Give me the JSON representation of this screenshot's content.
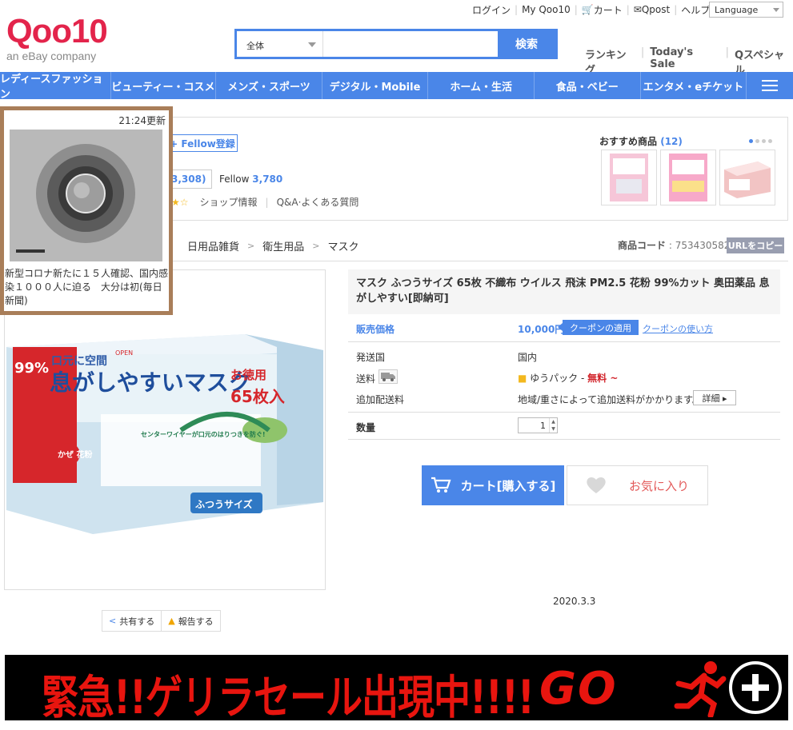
{
  "header": {
    "top_links": [
      "ログイン",
      "My Qoo10",
      "カート",
      "Qpost",
      "ヘルプ"
    ],
    "language_label": "Language",
    "logo_text": "Qoo10",
    "logo_sub": "an eBay company",
    "search": {
      "category": "全体",
      "button": "検索",
      "placeholder": ""
    },
    "sub_links": [
      "ランキング",
      "Today's Sale",
      "Qスペシャル"
    ]
  },
  "nav": {
    "items": [
      "レディースファッション",
      "ビューティー・コスメ",
      "メンズ・スポーツ",
      "デジタル・Mobile",
      "ホーム・生活",
      "食品・ベビー",
      "エンタメ・eチケット"
    ]
  },
  "shop": {
    "fellow_button": "+ Fellow登録",
    "review_count": "3,308)",
    "fellow_label": "Fellow",
    "fellow_count": "3,780",
    "shop_info": "ショップ情報",
    "qa": "Q&A·よくある質問",
    "recommend_title": "おすすめ商品",
    "recommend_count": "(12)"
  },
  "breadcrumb": [
    "日用品雑貨",
    "衛生用品",
    "マスク"
  ],
  "product": {
    "code_label": "商品コード",
    "code": ": 753430582",
    "url_copy": "URLをコピー",
    "title": "マスク ふつうサイズ 65枚 不織布 ウイルス 飛沫 PM2.5 花粉 99%カット 奥田薬品 息がしやすい[即納可]",
    "price_label": "販売価格",
    "price": "10,000円",
    "coupon_tag": "クーポンの適用",
    "coupon_link": "クーポンの使い方",
    "ship_from_label": "発送国",
    "ship_from": "国内",
    "shipping_label": "送料",
    "shipping_method": "ゆうパック -",
    "shipping_free": "無料 ~",
    "extra_label": "追加配送料",
    "extra_value": "地域/重さによって追加送料がかかります。",
    "detail_button": "詳細 ▸",
    "qty_label": "数量",
    "qty": "1",
    "cart_button": "カート[購入する]",
    "fav_button": "お気に入り",
    "share": "共有する",
    "report": "報告する",
    "box_text": {
      "main": "息がしやすいマスク",
      "sub": "口元に空間",
      "count": "65枚入",
      "value": "お徳用",
      "size": "ふつうサイズ",
      "pct": "99%",
      "wire": "センターワイヤーが口元のはりつきを防ぐ!",
      "pollen": "かぜ 花粉",
      "open": "OPEN"
    }
  },
  "date_text": "2020.3.3",
  "news": {
    "time": "21:24更新",
    "text": "新型コロナ新たに１５人確認、国内感染１０００人に迫る　大分は初(毎日新聞)"
  },
  "banner": {
    "text": "緊急!!ゲリラセール出現中!!!!",
    "go": "GO"
  },
  "colors": {
    "accent": "#4a86e8",
    "brand": "#e3244b",
    "banner_red": "#e8150f",
    "news_border": "#a97e59"
  }
}
